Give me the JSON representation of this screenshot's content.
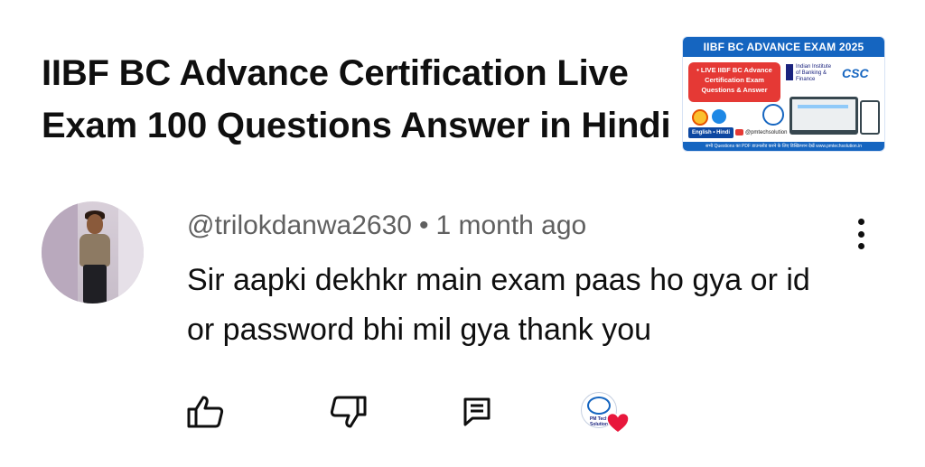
{
  "video": {
    "title": "IIBF BC Advance Certification Live Exam 100 Questions Answer in Hindi",
    "thumbnail": {
      "banner": "IIBF BC ADVANCE EXAM 2025",
      "pill_text": "• LIVE IIBF BC Advance Certification Exam Questions & Answer",
      "iibf_logo_text": "Indian Institute of Banking & Finance",
      "csc_logo_text": "CSC",
      "language_tag": "English • Hindi",
      "channel_handle": "@pmtechsolution",
      "footer_text": "सभी Questions का PDF डाउनलोड करने के लिए डिस्क्रिप्शन देखें www.pmtechsolution.in"
    }
  },
  "comment": {
    "author": "@trilokdanwa2630",
    "separator": "•",
    "time": "1 month ago",
    "text": "Sir aapki dekhkr main exam paas ho gya or id or password bhi mil gya thank you"
  },
  "actions": {
    "like": "like-icon",
    "dislike": "dislike-icon",
    "reply": "reply-icon",
    "creator_heart": "heart-icon"
  },
  "colors": {
    "meta_text": "#606060",
    "primary_text": "#0f0f0f",
    "heart": "#e8173c",
    "thumbnail_blue": "#1565c0",
    "thumbnail_red": "#e53935"
  }
}
